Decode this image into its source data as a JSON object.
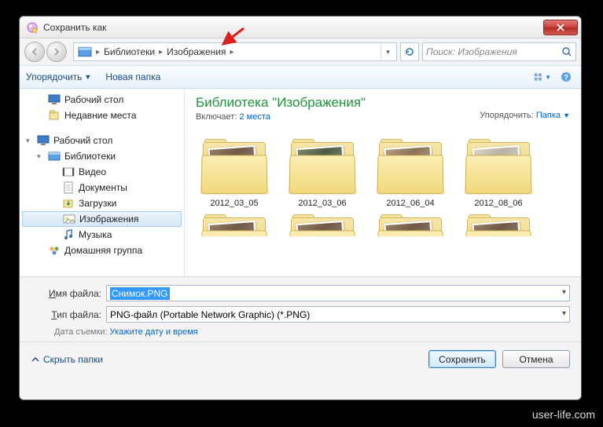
{
  "window": {
    "title": "Сохранить как"
  },
  "breadcrumb": {
    "items": [
      "Библиотеки",
      "Изображения"
    ],
    "search_placeholder": "Поиск: Изображения"
  },
  "toolbar": {
    "organize": "Упорядочить",
    "new_folder": "Новая папка"
  },
  "sidebar": {
    "desktop": "Рабочий стол",
    "recent": "Недавние места",
    "desktop2": "Рабочий стол",
    "libraries": "Библиотеки",
    "video": "Видео",
    "documents": "Документы",
    "downloads": "Загрузки",
    "pictures": "Изображения",
    "music": "Музыка",
    "homegroup": "Домашняя группа"
  },
  "library": {
    "title": "Библиотека \"Изображения\"",
    "includes_label": "Включает:",
    "includes_link": "2 места",
    "arrange_label": "Упорядочить:",
    "arrange_value": "Папка"
  },
  "folders": [
    {
      "name": "2012_03_05"
    },
    {
      "name": "2012_03_06"
    },
    {
      "name": "2012_06_04"
    },
    {
      "name": "2012_08_06"
    }
  ],
  "fields": {
    "filename_label_pre": "Имя файла",
    "filename_value": "Снимок.PNG",
    "filetype_label_pre": "Тип файла",
    "filetype_value": "PNG-файл (Portable Network Graphic) (*.PNG)",
    "date_label": "Дата съемки:",
    "date_link": "Укажите дату и время"
  },
  "actions": {
    "hide_folders": "Скрыть папки",
    "save": "Сохранить",
    "cancel": "Отмена"
  },
  "watermark": "user-life.com"
}
